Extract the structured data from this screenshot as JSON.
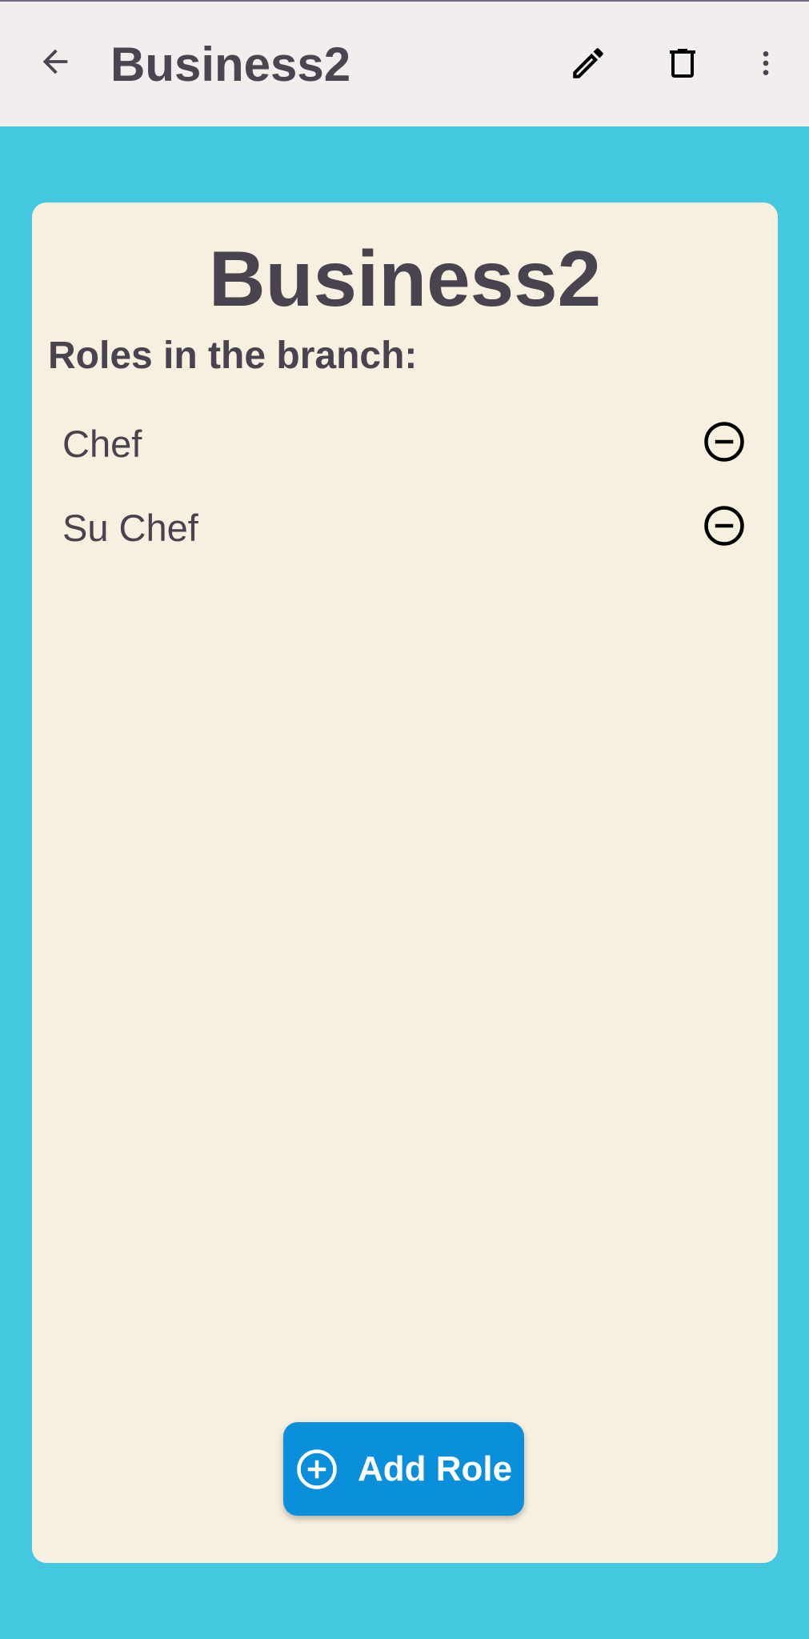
{
  "app_bar": {
    "title": "Business2",
    "icons": {
      "back": "arrow-back-icon",
      "edit": "pencil-icon",
      "delete": "trash-icon",
      "more": "more-vert-icon"
    }
  },
  "card": {
    "title": "Business2",
    "roles_heading": "Roles in the branch:",
    "roles": [
      {
        "label": "Chef",
        "remove_icon": "minus-circle-icon"
      },
      {
        "label": "Su Chef",
        "remove_icon": "minus-circle-icon"
      }
    ],
    "add_button": {
      "label": "Add Role",
      "icon": "plus-circle-icon"
    }
  },
  "colors": {
    "background": "#43c8e0",
    "app_bar": "#f3eeee",
    "card": "#f7efdf",
    "accent_button": "#0a8fda",
    "text": "#48434e"
  }
}
